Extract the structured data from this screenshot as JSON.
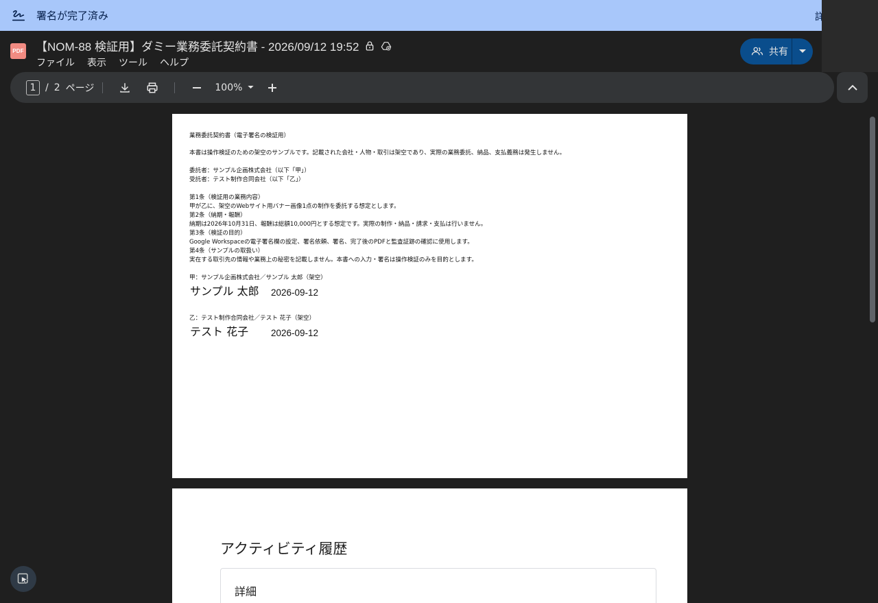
{
  "banner": {
    "text": "署名が完了済み",
    "detail": "詳細"
  },
  "titlebar": {
    "badge": "PDF",
    "title": "【NOM-88 検証用】ダミー業務委託契約書 - 2026/09/12 19:52",
    "menu": [
      "ファイル",
      "表示",
      "ツール",
      "ヘルプ"
    ],
    "share_label": "共有"
  },
  "toolbar": {
    "current_page": "1",
    "separator": "/",
    "total_pages": "2",
    "page_word": "ページ",
    "zoom": "100%"
  },
  "page1": {
    "lines": [
      "業務委託契約書（電子署名の検証用）",
      "本書は操作検証のための架空のサンプルです。記載された会社・人物・取引は架空であり、実際の業務委託、納品、支払義務は発生しません。",
      "委託者：サンプル企画株式会社（以下「甲」）",
      "受託者：テスト制作合同会社（以下「乙」）",
      "第1条（検証用の業務内容）",
      "甲が乙に、架空のWebサイト用バナー画像1点の制作を委託する想定とします。",
      "第2条（納期・報酬）",
      "納期は2026年10月31日、報酬は総額10,000円とする想定です。実際の制作・納品・請求・支払は行いません。",
      "第3条（検証の目的）",
      "Google Workspaceの電子署名欄の設定、署名依頼、署名、完了後のPDFと監査証跡の確認に使用します。",
      "第4条（サンプルの取扱い）",
      "実在する取引先の情報や業務上の秘密を記載しません。本書への入力・署名は操作検証のみを目的とします。",
      "甲：サンプル企画株式会社／サンプル 太郎（架空）",
      "乙：テスト制作合同会社／テスト 花子（架空）"
    ],
    "signatures": [
      {
        "name": "サンプル 太郎",
        "date": "2026-09-12"
      },
      {
        "name": "テスト 花子",
        "date": "2026-09-12"
      }
    ]
  },
  "page2": {
    "title": "アクティビティ履歴",
    "detail_label": "詳細"
  }
}
